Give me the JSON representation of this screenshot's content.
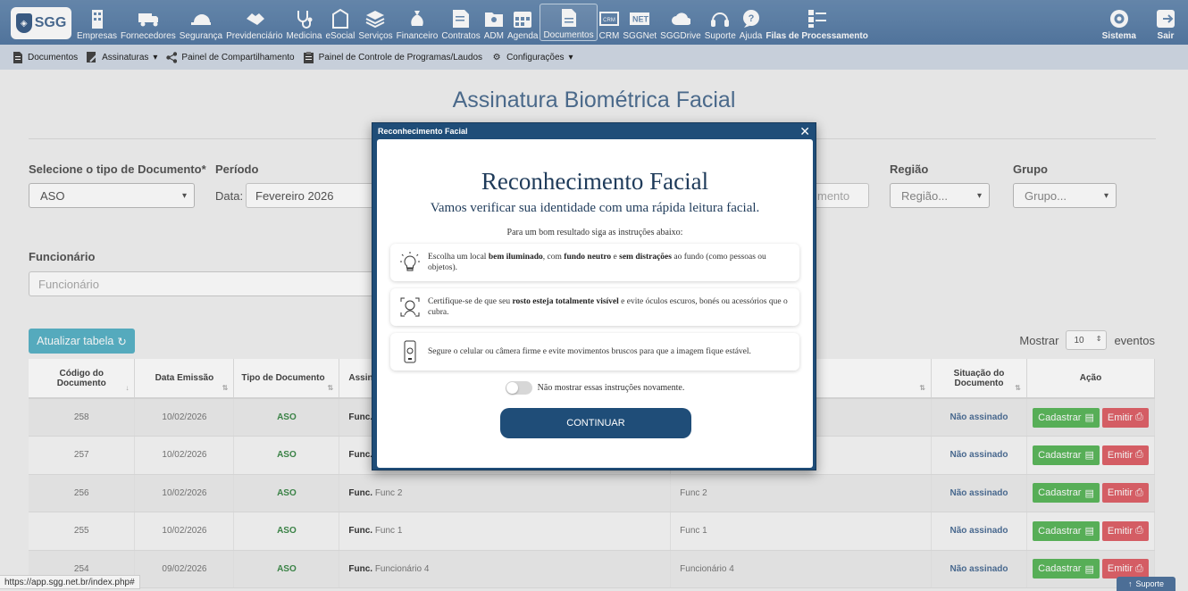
{
  "brand": {
    "logo_text": "SGG"
  },
  "nav": {
    "items": [
      {
        "label": "Empresas",
        "icon": "building-icon"
      },
      {
        "label": "Fornecedores",
        "icon": "truck-icon"
      },
      {
        "label": "Segurança",
        "icon": "hardhat-icon"
      },
      {
        "label": "Previdenciário",
        "icon": "handshake-icon"
      },
      {
        "label": "Medicina",
        "icon": "stethoscope-icon"
      },
      {
        "label": "eSocial",
        "icon": "esocial-icon"
      },
      {
        "label": "Serviços",
        "icon": "layers-icon"
      },
      {
        "label": "Financeiro",
        "icon": "moneybag-icon"
      },
      {
        "label": "Contratos",
        "icon": "contract-icon"
      },
      {
        "label": "ADM",
        "icon": "folder-user-icon"
      },
      {
        "label": "Agenda",
        "icon": "calendar-icon"
      },
      {
        "label": "Documentos",
        "icon": "document-icon"
      },
      {
        "label": "CRM",
        "icon": "crm-icon"
      },
      {
        "label": "SGGNet",
        "icon": "net-icon"
      },
      {
        "label": "SGGDrive",
        "icon": "cloud-drive-icon"
      },
      {
        "label": "Suporte",
        "icon": "headset-icon"
      },
      {
        "label": "Ajuda",
        "icon": "help-bubble-icon"
      },
      {
        "label": "Filas de Processamento",
        "icon": "queue-icon"
      }
    ],
    "right": [
      {
        "label": "Sistema",
        "icon": "system-gear-icon"
      },
      {
        "label": "Sair",
        "icon": "logout-icon"
      }
    ]
  },
  "subnav": {
    "documentos": "Documentos",
    "assinaturas": "Assinaturas",
    "compartilhamento": "Painel de Compartilhamento",
    "controle": "Painel de Controle de Programas/Laudos",
    "configuracoes": "Configurações"
  },
  "page": {
    "title": "Assinatura Biométrica Facial",
    "filters": {
      "tipo_label": "Selecione o tipo de Documento*",
      "tipo_value": "ASO",
      "periodo_label": "Período",
      "data_label": "Data:",
      "data_value": "Fevereiro 2026",
      "mento_placeholder": "mento",
      "regiao_label": "Região",
      "regiao_value": "Região...",
      "grupo_label": "Grupo",
      "grupo_value": "Grupo...",
      "funcionario_label": "Funcionário",
      "funcionario_placeholder": "Funcionário"
    },
    "update_button": "Atualizar tabela",
    "mostrar_label": "Mostrar",
    "mostrar_value": "10",
    "eventos_label": "eventos"
  },
  "table": {
    "headers": {
      "codigo": "Código do Documento",
      "data": "Data Emissão",
      "tipo": "Tipo de Documento",
      "assinatura": "Assina",
      "situacao": "Situação do Documento",
      "acao": "Ação"
    },
    "rows": [
      {
        "codigo": "258",
        "data": "10/02/2026",
        "tipo": "ASO",
        "func_prefix": "Func.",
        "func_name": "",
        "func_col": "",
        "situacao": "Não assinado"
      },
      {
        "codigo": "257",
        "data": "10/02/2026",
        "tipo": "ASO",
        "func_prefix": "Func.",
        "func_name": "",
        "func_col": "",
        "situacao": "Não assinado"
      },
      {
        "codigo": "256",
        "data": "10/02/2026",
        "tipo": "ASO",
        "func_prefix": "Func.",
        "func_name": "Func 2",
        "func_col": "Func 2",
        "situacao": "Não assinado"
      },
      {
        "codigo": "255",
        "data": "10/02/2026",
        "tipo": "ASO",
        "func_prefix": "Func.",
        "func_name": "Func 1",
        "func_col": "Func 1",
        "situacao": "Não assinado"
      },
      {
        "codigo": "254",
        "data": "09/02/2026",
        "tipo": "ASO",
        "func_prefix": "Func.",
        "func_name": "Funcionário 4",
        "func_col": "Funcionário 4",
        "situacao": "Não assinado"
      }
    ],
    "cadastrar_label": "Cadastrar",
    "emitir_label": "Emitir"
  },
  "modal": {
    "title": "Reconhecimento Facial",
    "heading": "Reconhecimento Facial",
    "subheading": "Vamos verificar sua identidade com uma rápida leitura facial.",
    "hint": "Para um bom resultado siga as instruções abaixo:",
    "tip1": {
      "a": "Escolha um local ",
      "b1": "bem iluminado",
      "c": ", com ",
      "b2": "fundo neutro",
      "d": " e ",
      "b3": "sem distrações",
      "e": " ao fundo (como pessoas ou objetos)."
    },
    "tip2": {
      "a": "Certifique-se de que seu ",
      "b1": "rosto esteja totalmente visível",
      "c": " e evite óculos escuros, bonés ou acessórios que o cubra."
    },
    "tip3": {
      "a": "Segure o celular ou câmera firme e evite movimentos bruscos para que a imagem fique estável."
    },
    "toggle_label": "Não mostrar essas instruções novamente.",
    "continue_button": "CONTINUAR"
  },
  "status": {
    "url": "https://app.sgg.net.br/index.php#",
    "suporte": "Suporte"
  },
  "colors": {
    "primary": "#1f4d78",
    "nav": "#5a7fa8",
    "success": "#5cb85c",
    "danger": "#e0636a",
    "teal": "#5ab4c8"
  }
}
